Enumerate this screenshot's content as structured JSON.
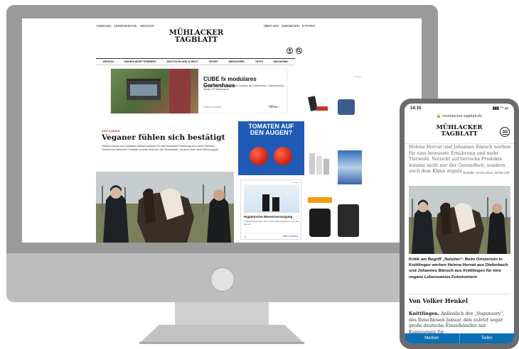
{
  "desktop": {
    "topbar_left": [
      "ANZEIGEN",
      "LESERSERVICE",
      "ABOSHOP"
    ],
    "topbar_right": [
      "ÜBER UNS",
      "IMMOBILIEN",
      "E-PAPER"
    ],
    "logo_line1": "MÜHLACKER",
    "logo_line2": "TAGBLATT",
    "icon_user": "user-icon",
    "icon_search": "search-icon",
    "nav": [
      "REGION",
      "BADEN-WÜRTTEMBERG",
      "DEUTSCHLAND & WELT",
      "SPORT",
      "MEDIATHEK",
      "TIPPS",
      "MAGAZINE"
    ],
    "ad_main": {
      "title": "CUBE fx modulares Gartenhaus",
      "text": "Isoliertes Design-Gartenhaus nutzbar als Gartenbüro, Gartenstudio, Atelier & Fitnessraum.",
      "link": "Cube fx GmbH",
      "cta": "Öffnen"
    },
    "article": {
      "kicker": "KNITTLINGEN",
      "headline": "Veganer fühlen sich bestätigt",
      "teaser1": "Helena Horvat und Johannes Bänsch werben für eine bewusste Ernährung und mehr Tierwohl.",
      "teaser2": "Verzicht auf tierische Produkte komme nicht nur der Gesundheit, sondern auch dem Klima zugute."
    },
    "tomato_ad": {
      "line1": "TOMATEN AUF",
      "line2": "DEN AUGEN?"
    },
    "ad_side": {
      "label": "Anzeige",
      "title": "Hygienische Wasserversorgung",
      "text": "Trinkwasserspender und mobile Wasserstationen für jeden Einsatz.",
      "cta": "Mehr erfahren"
    },
    "sky_label": "Anzeige"
  },
  "phone": {
    "time": "14:15",
    "status_icons": "▮▮▮ ◠ ▭",
    "url": "🔒 muehlacker-tagblatt.de",
    "logo_line1": "MÜHLACKER",
    "logo_line2": "TAGBLATT",
    "intro": "Helena Horvat und Johannes Bänsch werben für eine bewusste Ernährung und mehr Tierwohl. Verzicht auf tierische Produkte komme nicht nur der Gesundheit, sondern auch dem Klima zugute.",
    "date": "Erstellt: 22.01.2021, 00:00 Uhr",
    "caption": "Kritik am Begriff „Nutztier“: Beim Ortstermin in Knittlingen werben Helena Horvat aus Diefenbach und Johannes Bänsch aus Knittlingen für eine vegane Lebensweise.Fotomoment",
    "author": "Von Volker Henkel",
    "body_lead": "Knittlingen.",
    "body": " Anlässlich des „Veganuary“, des fleischlosen Januar, den zuletzt sogar große deutsche Einzelhändler mit Kampagnen für",
    "bar_left": "Merken",
    "bar_right": "Teilen"
  }
}
